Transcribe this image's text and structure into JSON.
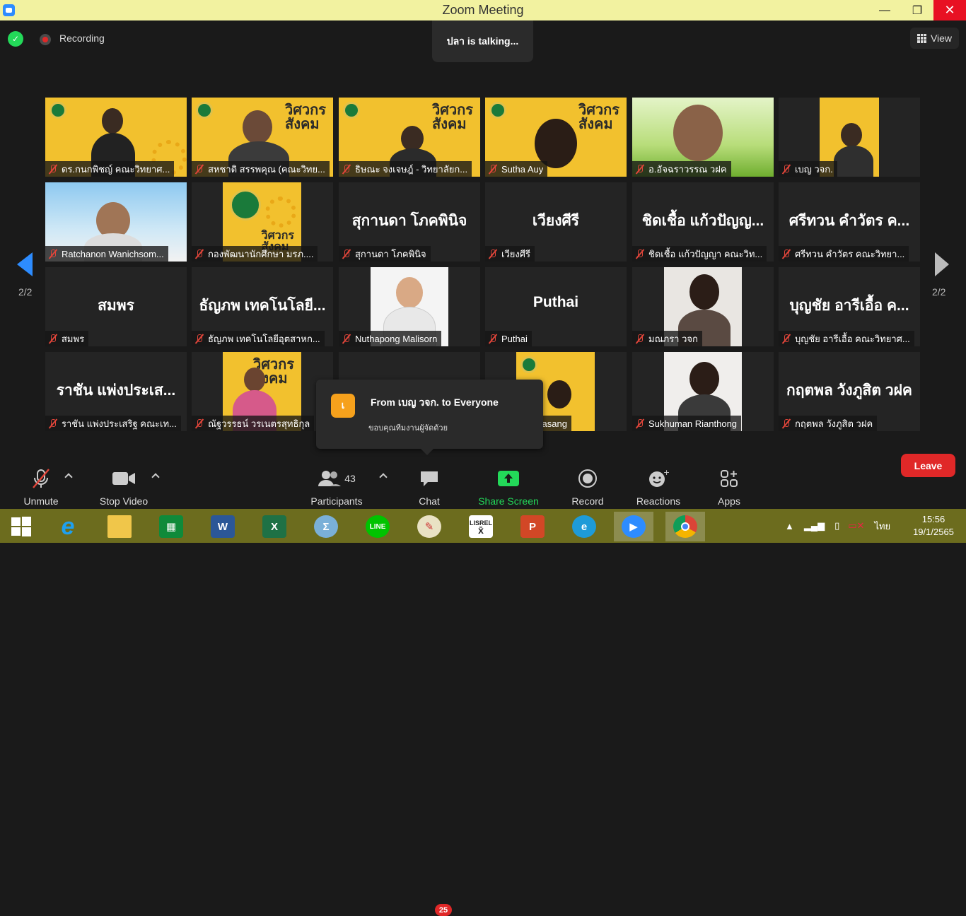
{
  "window": {
    "title": "Zoom Meeting",
    "minimize": "—",
    "maximize": "❐",
    "close": "✕"
  },
  "status": {
    "recording": "Recording",
    "talking": "ปลา is  talking...",
    "view": "View"
  },
  "paging": {
    "left": "2/2",
    "right": "2/2"
  },
  "tiles": [
    {
      "name": "ดร.กนกพิชญ์ คณะวิทยาศ..."
    },
    {
      "name": "สหชาติ สรรพคุณ (คณะวิทย..."
    },
    {
      "name": "ธิษณะ จงเจษฎ์ - วิทยาลัยก..."
    },
    {
      "name": "Sutha Auy"
    },
    {
      "name": "อ.อัจฉราวรรณ วฝค"
    },
    {
      "name": "เบญ วจก."
    },
    {
      "name": "Ratchanon Wanichsom..."
    },
    {
      "name": "กองพัฒนานักศึกษา มรภ...."
    },
    {
      "name": "สุกานดา โภคพินิจ",
      "big": "สุกานดา โภคพินิจ"
    },
    {
      "name": "เวียงศีรี",
      "big": "เวียงศีรี"
    },
    {
      "name": "ชิดเชื้อ แก้วปัญญา คณะวิท...",
      "big": "ชิดเชื้อ แก้วปัญญ..."
    },
    {
      "name": "ศรีทวน  คำวัตร คณะวิทยา...",
      "big": "ศรีทวน  คำวัตร ค..."
    },
    {
      "name": "สมพร",
      "big": "สมพร"
    },
    {
      "name": "ธัญภพ เทคโนโลยีอุตสาหก...",
      "big": "ธัญภพ เทคโนโลยี..."
    },
    {
      "name": "Nuthapong Malisorn"
    },
    {
      "name": "Puthai",
      "big": "Puthai"
    },
    {
      "name": "มณภรา วจก"
    },
    {
      "name": "บุญชัย อารีเอื้อ คณะวิทยาศ...",
      "big": "บุญชัย อารีเอื้อ ค..."
    },
    {
      "name": "ราชัน แพ่งประเสริฐ คณะเท...",
      "big": "ราชัน แพ่งประเส..."
    },
    {
      "name": "ณัฐวรรธน์ วรเนตรสุทธิกุล"
    },
    {
      "name": ""
    },
    {
      "name": "koograsang"
    },
    {
      "name": "Sukhuman Rianthong"
    },
    {
      "name": "กฤตพล วังภูสิต วฝค",
      "big": "กฤตพล วังภูสิต วฝค"
    }
  ],
  "banner": {
    "line1": "วิศวกร",
    "line2": "สังคม"
  },
  "chat": {
    "avatar": "เ",
    "from": "From เบญ วจก. to Everyone",
    "message": "ขอบคุณทีมงานผู้จัดด้วย"
  },
  "toolbar": {
    "unmute": "Unmute",
    "stop_video": "Stop Video",
    "participants": "Participants",
    "participants_count": "43",
    "chat": "Chat",
    "chat_badge": "25",
    "share": "Share Screen",
    "record": "Record",
    "reactions": "Reactions",
    "apps": "Apps",
    "leave": "Leave"
  },
  "taskbar": {
    "lisrel": "LISREL",
    "lang": "ไทย",
    "time": "15:56",
    "date": "19/1/2565"
  },
  "colors": {
    "accent": "#2d8cff",
    "leave": "#e02828",
    "share": "#23d959",
    "banner": "#f2c12e",
    "taskbar": "#6c6c1e"
  }
}
